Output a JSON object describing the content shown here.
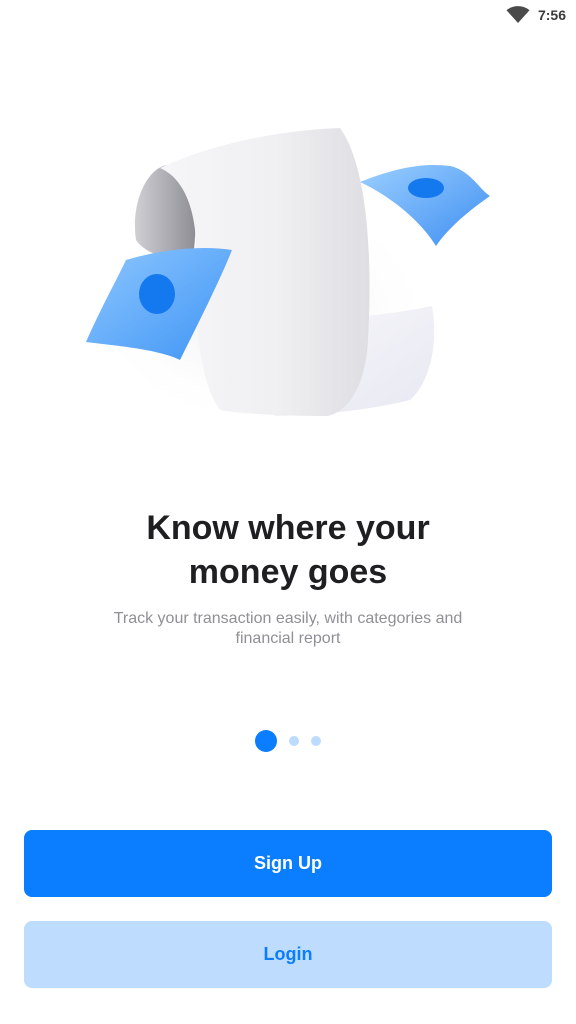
{
  "status_bar": {
    "time": "7:56",
    "wifi_icon": "wifi-icon"
  },
  "onboarding": {
    "illustration": "receipt-and-banknotes-illustration",
    "headline_line1": "Know where your",
    "headline_line2": "money goes",
    "subtitle_line1": "Track your transaction easily, with categories and",
    "subtitle_line2": "financial report",
    "page_indicator": {
      "total": 3,
      "current": 1
    }
  },
  "actions": {
    "signup_label": "Sign Up",
    "login_label": "Login"
  },
  "colors": {
    "accent": "#0b7dff",
    "accent_light": "#bddcfe",
    "headline": "#1f1f22",
    "subtitle": "#8f8f96"
  }
}
